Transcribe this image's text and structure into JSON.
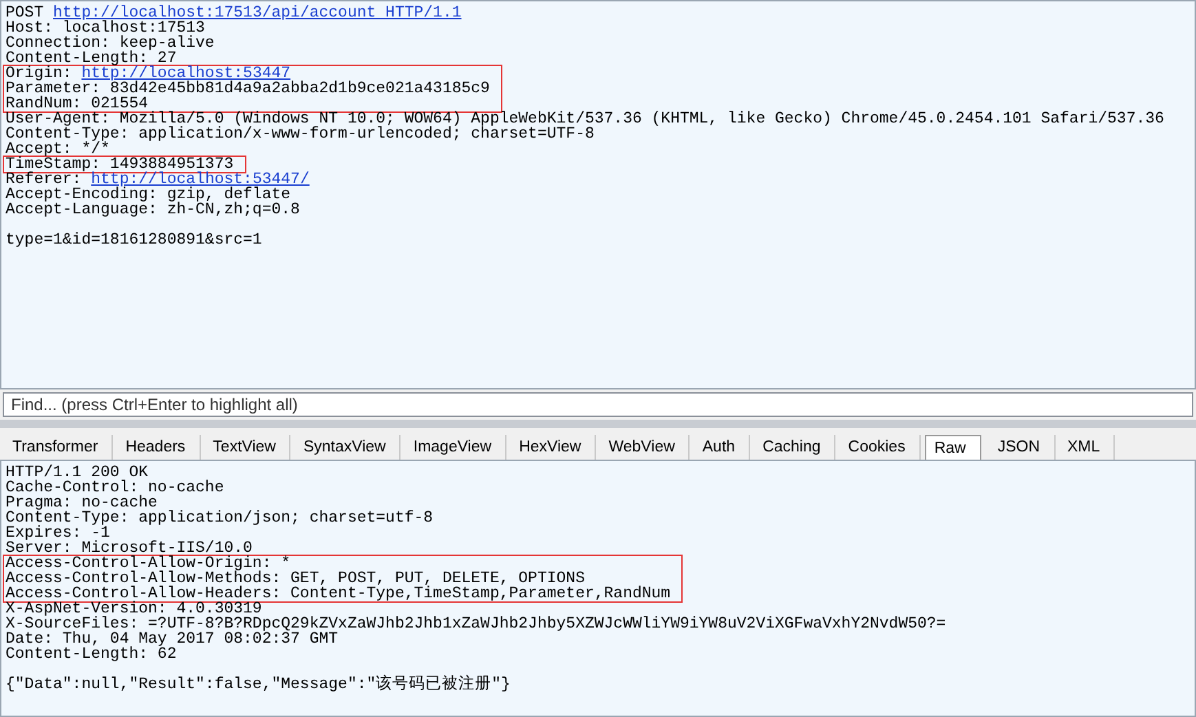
{
  "request": {
    "lines": [
      {
        "kind": "line",
        "text": "POST ",
        "link": "http://localhost:17513/api/account HTTP/1.1"
      },
      {
        "kind": "line",
        "text": "Host: localhost:17513"
      },
      {
        "kind": "line",
        "text": "Connection: keep-alive"
      },
      {
        "kind": "line",
        "text": "Content-Length: 27"
      },
      {
        "kind": "group",
        "lines": [
          {
            "kind": "line",
            "text": "Origin: ",
            "link": "http://localhost:53447"
          },
          {
            "kind": "line",
            "text": "Parameter: 83d42e45bb81d4a9a2abba2d1b9ce021a43185c9"
          },
          {
            "kind": "line",
            "text": "RandNum: 021554"
          }
        ]
      },
      {
        "kind": "line",
        "text": "User-Agent: Mozilla/5.0 (Windows NT 10.0; WOW64) AppleWebKit/537.36 (KHTML, like Gecko) Chrome/45.0.2454.101 Safari/537.36"
      },
      {
        "kind": "line",
        "text": "Content-Type: application/x-www-form-urlencoded; charset=UTF-8"
      },
      {
        "kind": "line",
        "text": "Accept: */*"
      },
      {
        "kind": "group",
        "lines": [
          {
            "kind": "line",
            "text": "TimeStamp: 1493884951373"
          }
        ]
      },
      {
        "kind": "line",
        "text": "Referer: ",
        "link": "http://localhost:53447/"
      },
      {
        "kind": "line",
        "text": "Accept-Encoding: gzip, deflate"
      },
      {
        "kind": "line",
        "text": "Accept-Language: zh-CN,zh;q=0.8"
      },
      {
        "kind": "blank"
      },
      {
        "kind": "line",
        "text": "type=1&id=18161280891&src=1"
      }
    ]
  },
  "find": {
    "placeholder": "Find... (press Ctrl+Enter to highlight all)"
  },
  "tabs": [
    {
      "label": "Transformer",
      "selected": false
    },
    {
      "label": "Headers",
      "selected": false
    },
    {
      "label": "TextView",
      "selected": false
    },
    {
      "label": "SyntaxView",
      "selected": false
    },
    {
      "label": "ImageView",
      "selected": false
    },
    {
      "label": "HexView",
      "selected": false
    },
    {
      "label": "WebView",
      "selected": false
    },
    {
      "label": "Auth",
      "selected": false
    },
    {
      "label": "Caching",
      "selected": false
    },
    {
      "label": "Cookies",
      "selected": false
    },
    {
      "label": "Raw",
      "selected": true
    },
    {
      "label": "JSON",
      "selected": false
    },
    {
      "label": "XML",
      "selected": false
    }
  ],
  "response": {
    "lines": [
      {
        "kind": "line",
        "text": "HTTP/1.1 200 OK"
      },
      {
        "kind": "line",
        "text": "Cache-Control: no-cache"
      },
      {
        "kind": "line",
        "text": "Pragma: no-cache"
      },
      {
        "kind": "line",
        "text": "Content-Type: application/json; charset=utf-8"
      },
      {
        "kind": "line",
        "text": "Expires: -1"
      },
      {
        "kind": "line",
        "text": "Server: Microsoft-IIS/10.0"
      },
      {
        "kind": "group",
        "lines": [
          {
            "kind": "line",
            "text": "Access-Control-Allow-Origin: *"
          },
          {
            "kind": "line",
            "text": "Access-Control-Allow-Methods: GET, POST, PUT, DELETE, OPTIONS"
          },
          {
            "kind": "line",
            "text": "Access-Control-Allow-Headers: Content-Type,TimeStamp,Parameter,RandNum"
          }
        ]
      },
      {
        "kind": "line",
        "text": "X-AspNet-Version: 4.0.30319"
      },
      {
        "kind": "line",
        "text": "X-SourceFiles: =?UTF-8?B?RDpcQ29kZVxZaWJhb2Jhb1xZaWJhb2Jhby5XZWJcWWliYW9iYW8uV2ViXGFwaVxhY2NvdW50?="
      },
      {
        "kind": "line",
        "text": "Date: Thu, 04 May 2017 08:02:37 GMT"
      },
      {
        "kind": "line",
        "text": "Content-Length: 62"
      },
      {
        "kind": "blank"
      },
      {
        "kind": "line",
        "text": "{\"Data\":null,\"Result\":false,\"Message\":\"该号码已被注册\"}"
      }
    ]
  }
}
